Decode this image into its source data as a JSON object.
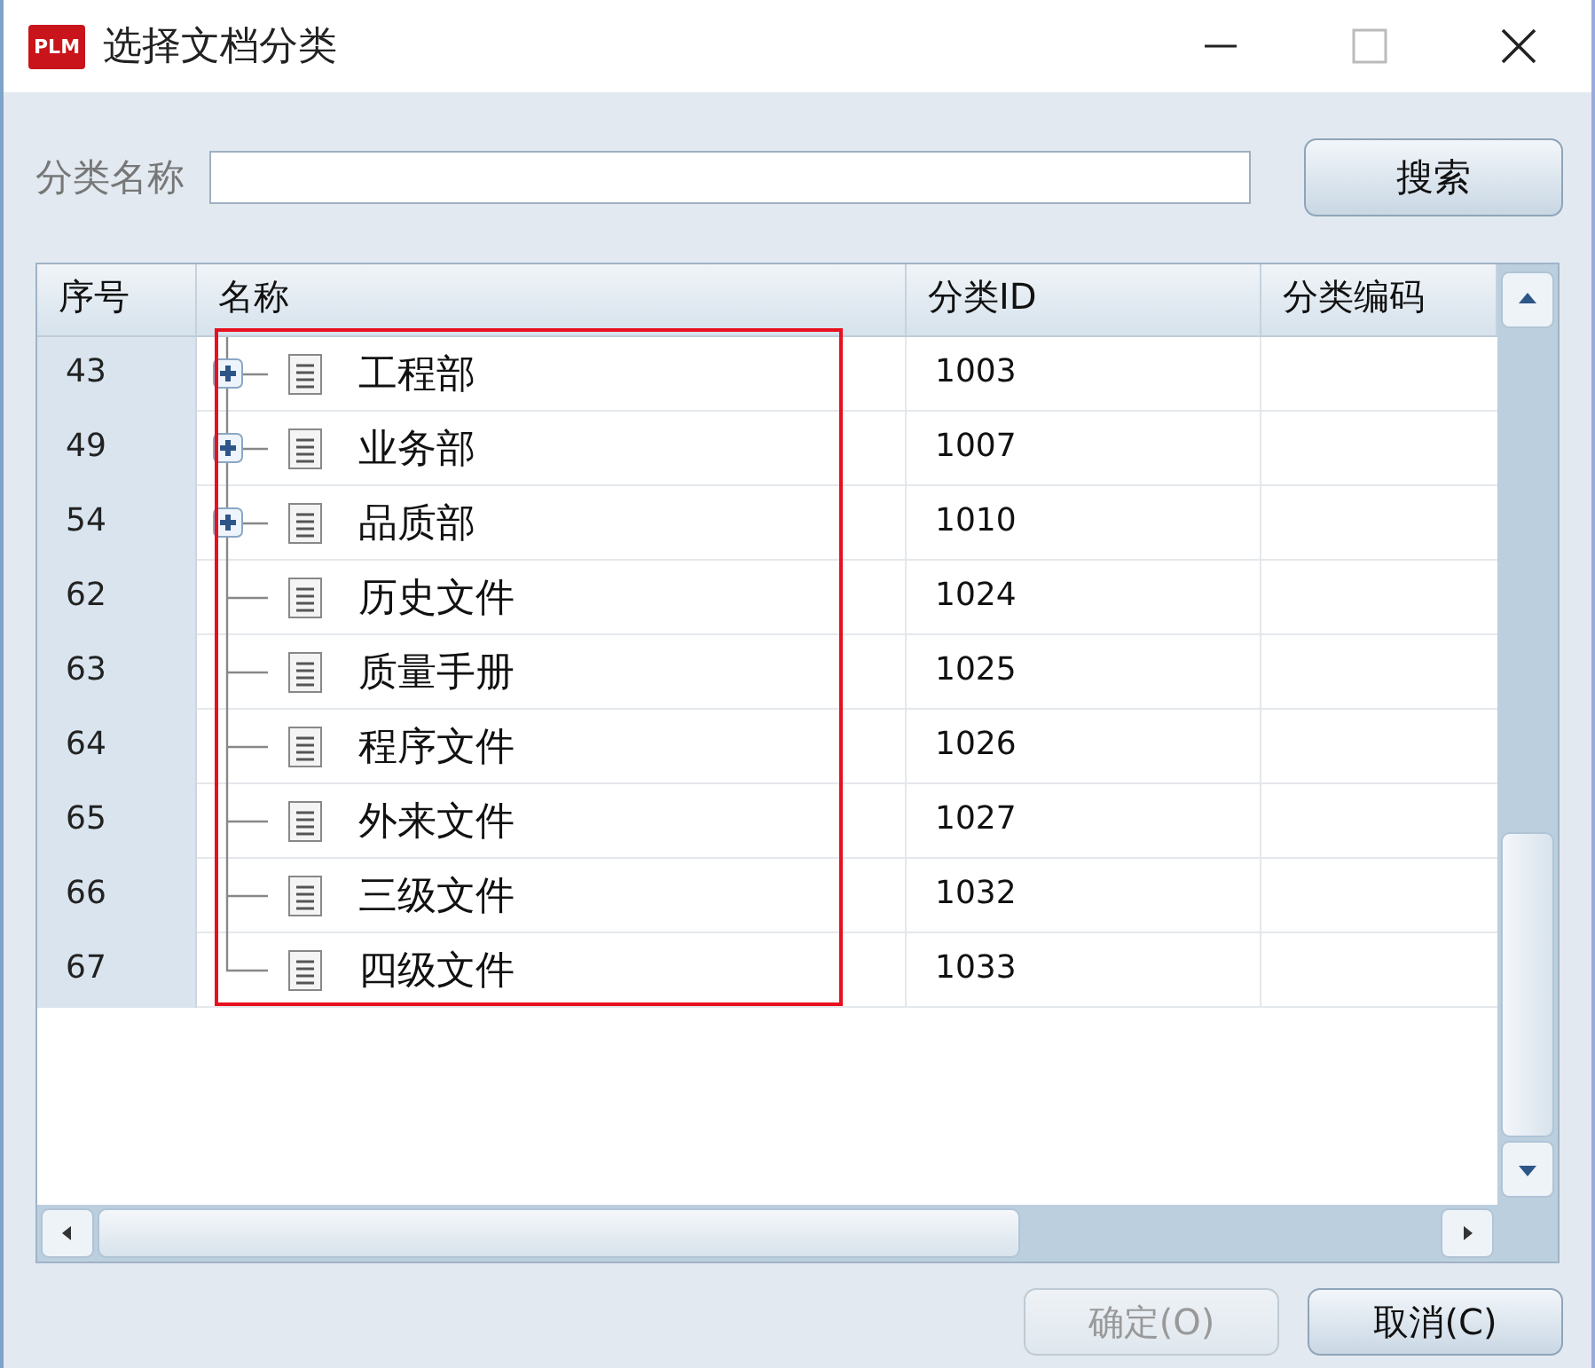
{
  "window": {
    "title": "选择文档分类",
    "logo": "PLM"
  },
  "search": {
    "label": "分类名称",
    "button": "搜索"
  },
  "table": {
    "columns": [
      "序号",
      "名称",
      "分类ID",
      "分类编码"
    ],
    "rows": [
      {
        "no": "43",
        "name": "工程部",
        "id": "1003",
        "kind": "group",
        "expanded": false
      },
      {
        "no": "49",
        "name": "业务部",
        "id": "1007",
        "kind": "group",
        "expanded": false
      },
      {
        "no": "54",
        "name": "品质部",
        "id": "1010",
        "kind": "group",
        "expanded": false
      },
      {
        "no": "62",
        "name": "历史文件",
        "id": "1024",
        "kind": "leaf"
      },
      {
        "no": "63",
        "name": "质量手册",
        "id": "1025",
        "kind": "leaf"
      },
      {
        "no": "64",
        "name": "程序文件",
        "id": "1026",
        "kind": "leaf"
      },
      {
        "no": "65",
        "name": "外来文件",
        "id": "1027",
        "kind": "leaf"
      },
      {
        "no": "66",
        "name": "三级文件",
        "id": "1032",
        "kind": "leaf"
      },
      {
        "no": "67",
        "name": "四级文件",
        "id": "1033",
        "kind": "leaf"
      }
    ]
  },
  "buttons": [
    {
      "label": "确定(O)",
      "disabled": true
    },
    {
      "label": "取消(C)",
      "disabled": false
    }
  ]
}
